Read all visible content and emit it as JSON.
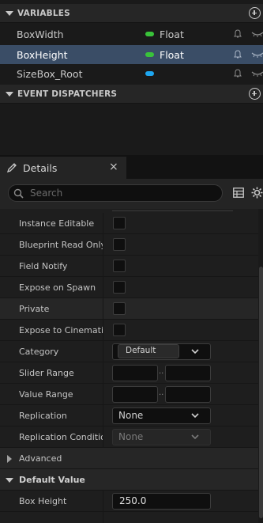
{
  "my_blueprint": {
    "variables_header": "VARIABLES",
    "variables": [
      {
        "name": "BoxWidth",
        "type": "Float",
        "type_color": "#39c23a",
        "selected": false
      },
      {
        "name": "BoxHeight",
        "type": "Float",
        "type_color": "#39c23a",
        "selected": true
      },
      {
        "name": "SizeBox_Root",
        "type": "",
        "type_color": "#1ea6f0",
        "selected": false
      }
    ],
    "event_dispatchers_header": "EVENT DISPATCHERS"
  },
  "details": {
    "tab_label": "Details",
    "close_glyph": "×",
    "search_placeholder": "Search",
    "properties": [
      {
        "label": "Instance Editable",
        "kind": "checkbox"
      },
      {
        "label": "Blueprint Read Only",
        "kind": "checkbox"
      },
      {
        "label": "Field Notify",
        "kind": "checkbox"
      },
      {
        "label": "Expose on Spawn",
        "kind": "checkbox"
      },
      {
        "label": "Private",
        "kind": "checkbox"
      },
      {
        "label": "Expose to Cinematics",
        "kind": "checkbox"
      },
      {
        "label": "Category",
        "kind": "category",
        "value": "Default"
      },
      {
        "label": "Slider Range",
        "kind": "range",
        "separator": ".."
      },
      {
        "label": "Value Range",
        "kind": "range",
        "separator": ".."
      },
      {
        "label": "Replication",
        "kind": "combo",
        "value": "None"
      },
      {
        "label": "Replication Condition",
        "kind": "combo-disabled",
        "value": "None"
      }
    ],
    "advanced_label": "Advanced",
    "default_value_header": "Default Value",
    "default_value_field": {
      "label": "Box Height",
      "value": "250.0"
    }
  }
}
